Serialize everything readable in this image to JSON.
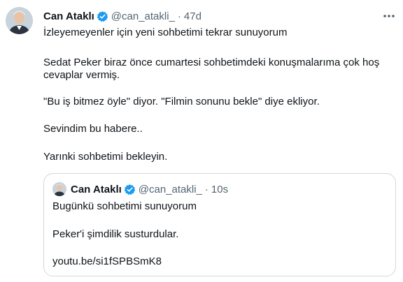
{
  "tweet": {
    "author_name": "Can Ataklı",
    "handle": "@can_atakli_",
    "separator": "·",
    "time": "47d",
    "lines": [
      "İzleyemeyenler için yeni sohbetimi tekrar sunuyorum",
      "Sedat Peker biraz önce cumartesi sohbetimdeki konuşmalarıma çok hoş",
      "cevaplar vermiş.",
      "\"Bu iş bitmez öyle\" diyor. \"Filmin sonunu bekle\" diye ekliyor.",
      "Sevindim bu habere..",
      "Yarınki sohbetimi bekleyin."
    ]
  },
  "quoted": {
    "author_name": "Can Ataklı",
    "handle": "@can_atakli_",
    "separator": "·",
    "time": "10s",
    "lines": [
      "Bugünkü sohbetimi sunuyorum",
      "Peker'i şimdilik susturdular.",
      "youtu.be/si1fSPBSmK8"
    ]
  },
  "icons": {
    "verified": "verified-badge-icon",
    "more": "more-options-icon"
  },
  "colors": {
    "verified": "#1d9bf0",
    "secondary_text": "#536471",
    "border": "#cfd9de"
  }
}
